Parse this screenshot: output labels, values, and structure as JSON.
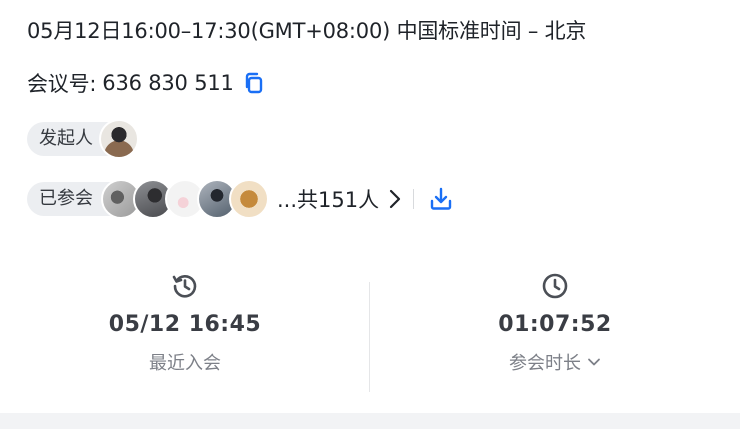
{
  "meeting": {
    "time_text": "05月12日16:00–17:30(GMT+08:00) 中国标准时间 – 北京",
    "id_label": "会议号:",
    "id_value": "636 830 511"
  },
  "initiator": {
    "label": "发起人"
  },
  "attendees": {
    "label": "已参会",
    "more_text": "...共151人"
  },
  "stats": {
    "last_join": {
      "value": "05/12 16:45",
      "label": "最近入会"
    },
    "duration": {
      "value": "01:07:52",
      "label": "参会时长"
    }
  },
  "colors": {
    "accent": "#1a6ff5",
    "icon_gray": "#4b4f56",
    "chip_bg": "#eceef1"
  },
  "icons": [
    "copy-icon",
    "chevron-right-icon",
    "download-icon",
    "history-clock-icon",
    "clock-icon",
    "chevron-down-icon"
  ]
}
